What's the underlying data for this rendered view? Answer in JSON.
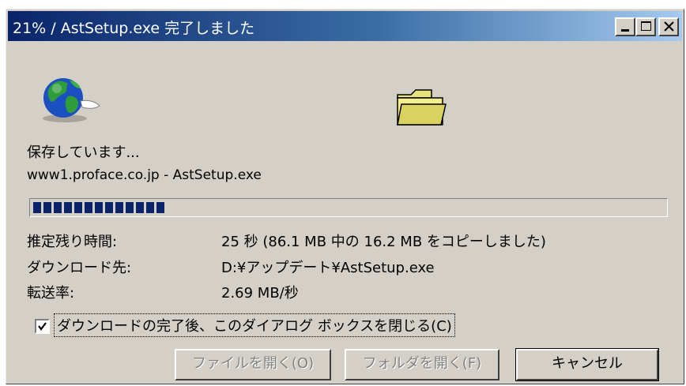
{
  "window": {
    "title": "21% / AstSetup.exe 完了しました"
  },
  "titlebar_buttons": [
    {
      "name": "minimize-icon"
    },
    {
      "name": "maximize-icon"
    },
    {
      "name": "close-icon"
    }
  ],
  "icons": {
    "source": "globe-icon",
    "destination": "folder-icon"
  },
  "status": {
    "saving": "保存しています...",
    "source": "www1.proface.co.jp - AstSetup.exe"
  },
  "progress": {
    "percent": 21,
    "color": "#0a246a"
  },
  "details": [
    {
      "label": "推定残り時間:",
      "value": "25 秒 (86.1 MB 中の 16.2 MB をコピーしました)"
    },
    {
      "label": "ダウンロード先:",
      "value": "D:¥アップデート¥AstSetup.exe"
    },
    {
      "label": "転送率:",
      "value": "2.69 MB/秒"
    }
  ],
  "close_on_complete": {
    "checked": true,
    "label": "ダウンロードの完了後、このダイアログ ボックスを閉じる(C)"
  },
  "buttons": {
    "open_file": "ファイルを開く(O)",
    "open_folder": "フォルダを開く(F)",
    "cancel": "キャンセル"
  }
}
